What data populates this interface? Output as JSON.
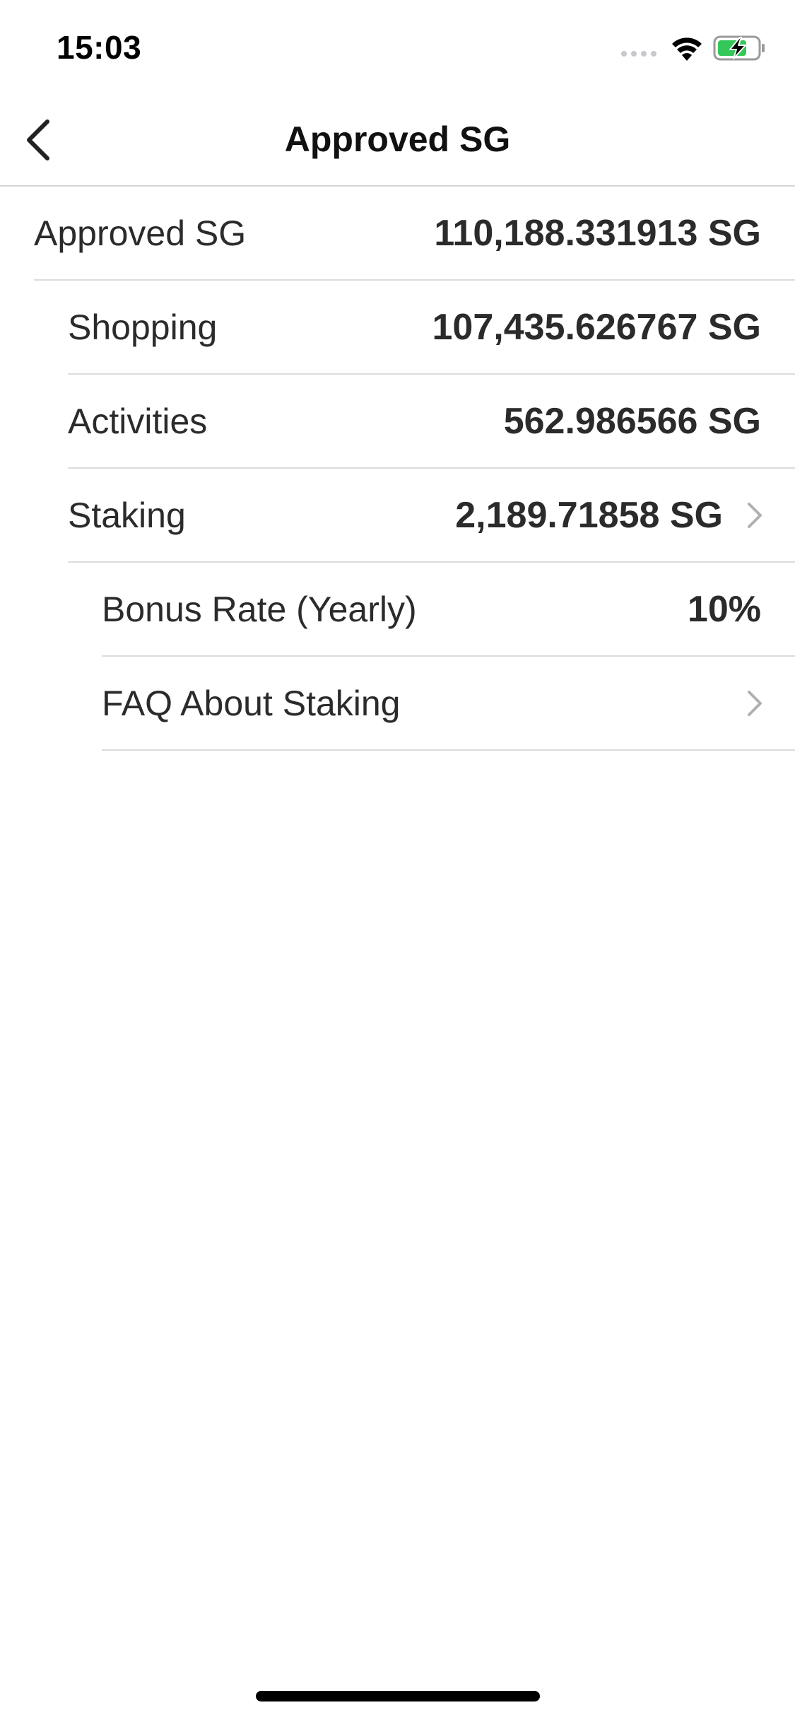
{
  "status_bar": {
    "time": "15:03",
    "icons": [
      "cellular-signal-icon",
      "wifi-icon",
      "battery-charging-icon"
    ],
    "battery_color": "#34c759"
  },
  "nav": {
    "title": "Approved SG",
    "back_icon": "chevron-left-icon"
  },
  "rows": [
    {
      "label": "Approved SG",
      "value": "110,188.331913 SG"
    },
    {
      "label": "Shopping",
      "value": "107,435.626767 SG"
    },
    {
      "label": "Activities",
      "value": "562.986566 SG"
    },
    {
      "label": "Staking",
      "value": "2,189.71858 SG",
      "chevron": "chevron-right-icon"
    },
    {
      "label": "Bonus Rate (Yearly)",
      "value": "10%"
    },
    {
      "label": "FAQ About Staking",
      "value": "",
      "chevron": "chevron-right-icon"
    }
  ],
  "colors": {
    "text": "#2b2b2b",
    "separator": "#dcdcdc",
    "chevron": "#b0b0b0",
    "background": "#ffffff"
  }
}
